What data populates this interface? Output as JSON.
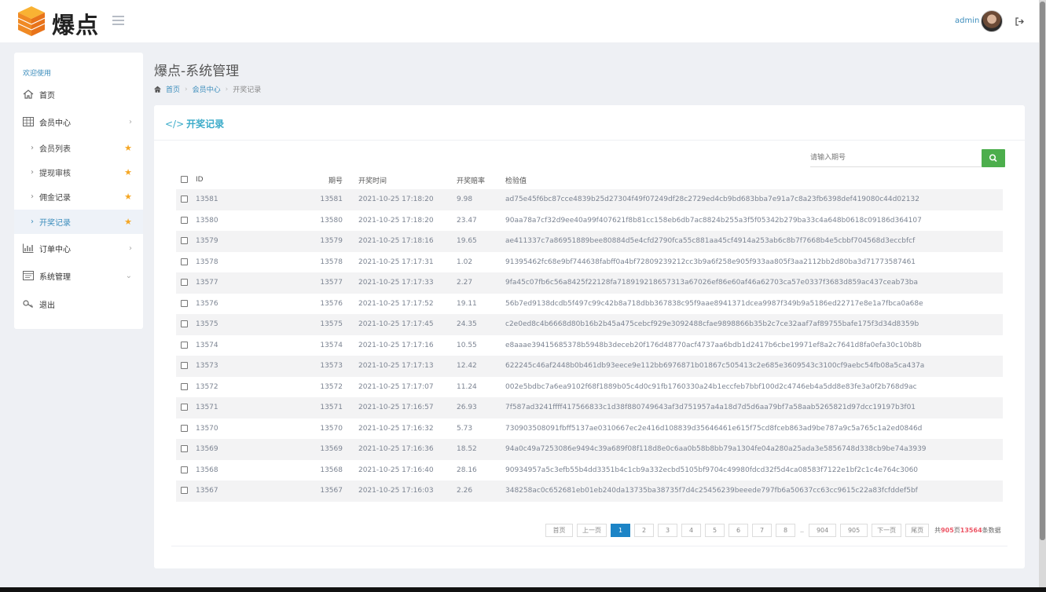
{
  "header": {
    "brand": "爆点",
    "admin_name": "admin"
  },
  "sidebar": {
    "welcome": "欢迎使用",
    "home": "首页",
    "member_center": "会员中心",
    "sub_items": [
      {
        "label": "会员列表"
      },
      {
        "label": "提现审核"
      },
      {
        "label": "佣金记录"
      },
      {
        "label": "开奖记录"
      }
    ],
    "order_center": "订单中心",
    "system_mgmt": "系统管理",
    "logout": "退出"
  },
  "page": {
    "title": "爆点-系统管理",
    "breadcrumb": [
      "首页",
      "会员中心",
      "开奖记录"
    ]
  },
  "panel": {
    "title": "开奖记录",
    "search_placeholder": "请输入期号"
  },
  "table": {
    "columns": [
      "ID",
      "期号",
      "开奖时间",
      "开奖赔率",
      "检验值"
    ],
    "rows": [
      [
        "13581",
        "13581",
        "2021-10-25 17:18:20",
        "9.98",
        "ad75e45f6bc87cce4839b25d27304f49f07249df28c2729ed4cb9bd683bba7e91a7c8a23fb6398def419080c44d02132"
      ],
      [
        "13580",
        "13580",
        "2021-10-25 17:18:20",
        "23.47",
        "90aa78a7cf32d9ee40a99f407621f8b81cc158eb6db7ac8824b255a3f5f05342b279ba33c4a648b0618c09186d364107"
      ],
      [
        "13579",
        "13579",
        "2021-10-25 17:18:16",
        "19.65",
        "ae411337c7a86951889bee80884d5e4cfd2790fca55c881aa45cf4914a253ab6c8b7f7668b4e5cbbf704568d3eccbfcf"
      ],
      [
        "13578",
        "13578",
        "2021-10-25 17:17:31",
        "1.02",
        "91395462fc68e9bf744638fabff0a4bf72809239212cc3b9a6f258e905f933aa805f3aa2112bb2d80ba3d71773587461"
      ],
      [
        "13577",
        "13577",
        "2021-10-25 17:17:33",
        "2.27",
        "9fa45c07fb6c56a8425f22128fa718919218657313a67026ef86e60af46a62703ca57e0337f3683d859ac437ceab73ba"
      ],
      [
        "13576",
        "13576",
        "2021-10-25 17:17:52",
        "19.11",
        "56b7ed9138dcdb5f497c99c42b8a718dbb367838c95f9aae8941371dcea9987f349b9a5186ed22717e8e1a7fbca0a68e"
      ],
      [
        "13575",
        "13575",
        "2021-10-25 17:17:45",
        "24.35",
        "c2e0ed8c4b6668d80b16b2b45a475cebcf929e3092488cfae9898866b35b2c7ce32aaf7af89755bafe175f3d34d8359b"
      ],
      [
        "13574",
        "13574",
        "2021-10-25 17:17:16",
        "10.55",
        "e8aaae39415685378b5948b3deceb20f176d48770acf4737aa6bdb1d2417b6cbe19971ef8a2c7641d8fa0efa30c10b8b"
      ],
      [
        "13573",
        "13573",
        "2021-10-25 17:17:13",
        "12.42",
        "622245c46af2448b0b461db93eece9e112bb6976871b01867c505413c2e685e3609543c3100cf9aebc54fb08a5ca437a"
      ],
      [
        "13572",
        "13572",
        "2021-10-25 17:17:07",
        "11.24",
        "002e5bdbc7a6ea9102f68f1889b05c4d0c91fb1760330a24b1eccfeb7bbf100d2c4746eb4a5dd8e83fe3a0f2b768d9ac"
      ],
      [
        "13571",
        "13571",
        "2021-10-25 17:16:57",
        "26.93",
        "7f587ad3241ffff417566833c1d38f880749643af3d751957a4a18d7d5d6aa79bf7a58aab5265821d97dcc19197b3f01"
      ],
      [
        "13570",
        "13570",
        "2021-10-25 17:16:32",
        "5.73",
        "730903508091fbff5137ae0310667ec2e416d108839d35646461e615f75cd8fceb863ad9be787a9c5a765c1a2ed0846d"
      ],
      [
        "13569",
        "13569",
        "2021-10-25 17:16:36",
        "18.52",
        "94a0c49a7253086e9494c39a689f08f118d8e0c6aa0b58b8bb79a1304fe04a280a25ada3e5856748d338cb9be74a3939"
      ],
      [
        "13568",
        "13568",
        "2021-10-25 17:16:40",
        "28.16",
        "90934957a5c3efb55b4dd3351b4c1cb9a332ecbd5105bf9704c49980fdcd32f5d4ca08583f7122e1bf2c1c4e764c3060"
      ],
      [
        "13567",
        "13567",
        "2021-10-25 17:16:03",
        "2.26",
        "348258ac0c652681eb01eb240da13735ba38735f7d4c25456239beeede797fb6a50637cc63cc9615c22a83fcfddef5bf"
      ]
    ]
  },
  "pagination": {
    "first": "首页",
    "prev": "上一页",
    "pages": [
      "1",
      "2",
      "3",
      "4",
      "5",
      "6",
      "7",
      "8"
    ],
    "current": "1",
    "ellipsis": "..",
    "tail_pages": [
      "904",
      "905"
    ],
    "next": "下一页",
    "last": "尾页",
    "total_prefix": "共",
    "total_pages": "905",
    "total_mid": "页",
    "total_records": "13564",
    "total_suffix": "条数据"
  },
  "colors": {
    "accent": "#3c8dbc",
    "panel_title": "#3aabc9",
    "search_button": "#4cae4c",
    "active_page": "#1c84c6",
    "star": "#f5a623",
    "total_highlight": "#ed5565"
  },
  "icons": [
    "menu-icon",
    "logout-icon",
    "home-icon",
    "table-icon",
    "chart-icon",
    "window-icon",
    "key-icon",
    "star-icon",
    "code-icon",
    "search-icon"
  ]
}
